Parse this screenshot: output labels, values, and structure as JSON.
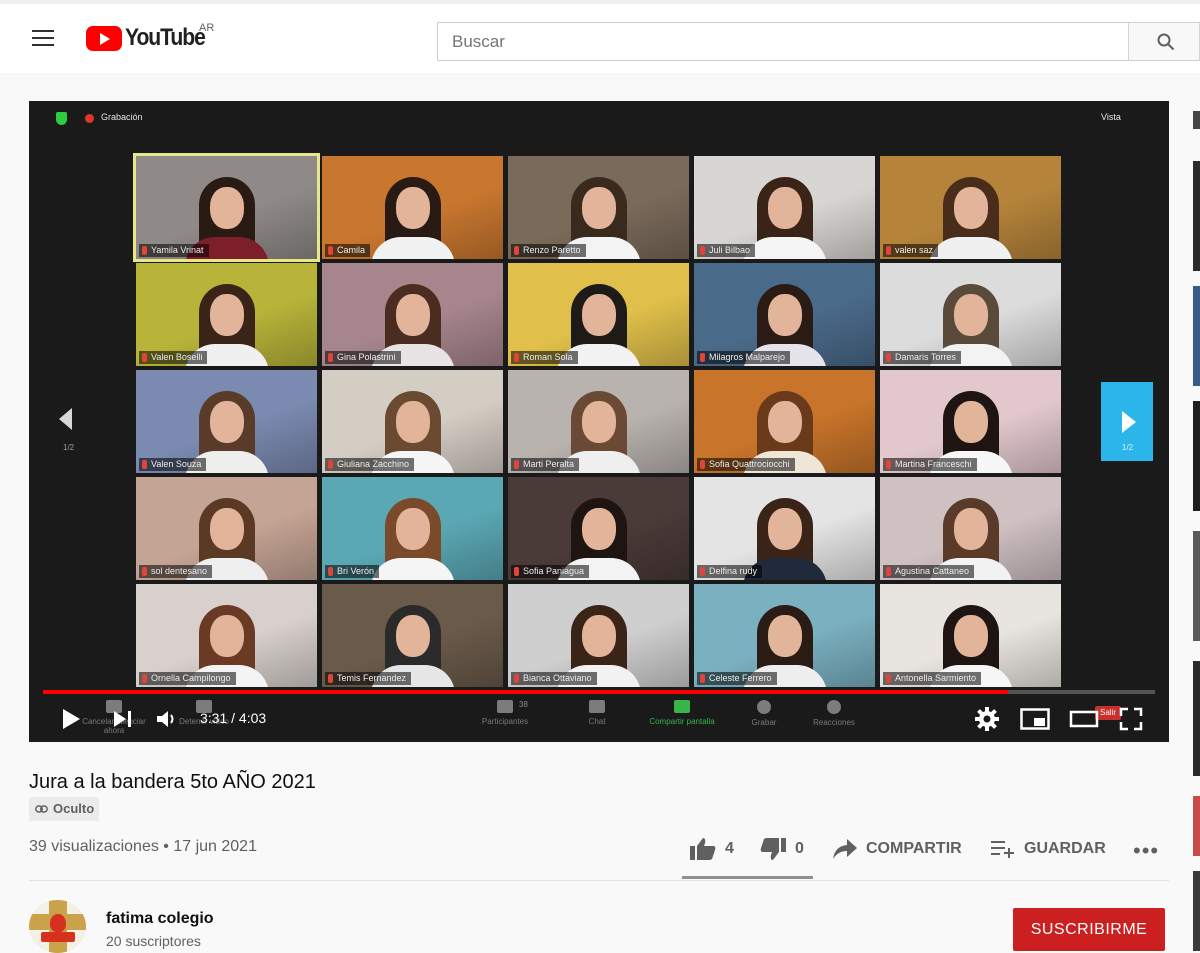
{
  "header": {
    "logo_text": "YouTube",
    "country_code": "AR",
    "search_placeholder": "Buscar"
  },
  "zoom": {
    "recording_label": "Grabación",
    "view_label": "Vista",
    "page_indicator_left": "1/2",
    "page_indicator_right": "1/2",
    "participants": [
      {
        "name": "Yamila Vrinat",
        "wall": "#8f8a88",
        "hair": "#2a1a14",
        "shirt": "#7d1f2a",
        "active": true
      },
      {
        "name": "Camila",
        "wall": "#c9772f",
        "hair": "#2a1a14",
        "shirt": "#f1f1f1"
      },
      {
        "name": "Renzo Paretto",
        "wall": "#7a6a5a",
        "hair": "#3a2a1e",
        "shirt": "#f3f3f3"
      },
      {
        "name": "Juli Bilbao",
        "wall": "#d8d6d2",
        "hair": "#3a2418",
        "shirt": "#f5f5f5"
      },
      {
        "name": "valen saz",
        "wall": "#b5843a",
        "hair": "#4a2c1a",
        "shirt": "#f0f0f0"
      },
      {
        "name": "Valen Boselli",
        "wall": "#b8b43a",
        "hair": "#3a2418",
        "shirt": "#f0f0f0"
      },
      {
        "name": "Gina Polastrini",
        "wall": "#a7858d",
        "hair": "#4a2c20",
        "shirt": "#e8e3e4"
      },
      {
        "name": "Roman Sola",
        "wall": "#e0c04a",
        "hair": "#1e1a18",
        "shirt": "#f2f2f2"
      },
      {
        "name": "Milagros Malparejo",
        "wall": "#4a6a8a",
        "hair": "#2a1c14",
        "shirt": "#e4e4ea"
      },
      {
        "name": "Damaris Torres",
        "wall": "#dcdcdc",
        "hair": "#5a4a3a",
        "shirt": "#f3f3f3"
      },
      {
        "name": "Valen Souza",
        "wall": "#7a8ab0",
        "hair": "#5a3a28",
        "shirt": "#eeeeee"
      },
      {
        "name": "Giuliana Zacchino",
        "wall": "#d4cdc4",
        "hair": "#6a4a30",
        "shirt": "#f5f5f5"
      },
      {
        "name": "Marti Peralta",
        "wall": "#b9b3af",
        "hair": "#6a4a34",
        "shirt": "#efefef"
      },
      {
        "name": "Sofia Quattrociocchi",
        "wall": "#c8742a",
        "hair": "#6a3a1a",
        "shirt": "#f0e6d8"
      },
      {
        "name": "Martina Franceschi",
        "wall": "#e2c8cc",
        "hair": "#1e1412",
        "shirt": "#f7f7f7"
      },
      {
        "name": "sol dentesano",
        "wall": "#c4a494",
        "hair": "#5a3a24",
        "shirt": "#efefef"
      },
      {
        "name": "Bri Verón",
        "wall": "#5aa8b4",
        "hair": "#7a4a2a",
        "shirt": "#f5f5f5"
      },
      {
        "name": "Sofia Paniagua",
        "wall": "#4a3a38",
        "hair": "#1e1412",
        "shirt": "#f3f3f3"
      },
      {
        "name": "Delfina rudy",
        "wall": "#e4e4e4",
        "hair": "#3a2418",
        "shirt": "#202a3a"
      },
      {
        "name": "Agustina Cattaneo",
        "wall": "#cfc0c2",
        "hair": "#5a3a28",
        "shirt": "#f2f2f2"
      },
      {
        "name": "Ornella Campilongo",
        "wall": "#d7d0cc",
        "hair": "#6a3a24",
        "shirt": "#f4f4f4"
      },
      {
        "name": "Temis Fernandez",
        "wall": "#6a5a4a",
        "hair": "#2a2a2a",
        "shirt": "#e6e6e6"
      },
      {
        "name": "Bianca Ottaviano",
        "wall": "#cfcfcf",
        "hair": "#3a2418",
        "shirt": "#f2f2f2"
      },
      {
        "name": "Celeste Ferrero",
        "wall": "#7ab0c0",
        "hair": "#2a1c14",
        "shirt": "#eeeeee"
      },
      {
        "name": "Antonella Sarmiento",
        "wall": "#e8e4df",
        "hair": "#1e1412",
        "shirt": "#f6f6f6"
      }
    ],
    "tools": {
      "cancel_mute": "Cancelar silenciar ahora",
      "stop_video": "Detener video",
      "participants": "Participantes",
      "participants_count": "38",
      "chat": "Chat",
      "share_screen": "Compartir pantalla",
      "record": "Grabar",
      "reactions": "Reacciones",
      "leave": "Salir"
    }
  },
  "player": {
    "current_time": "3:31 / 4:03",
    "progress_fraction": 0.868
  },
  "video": {
    "title": "Jura a la bandera 5to AÑO 2021",
    "visibility": "Oculto",
    "stats": "39 visualizaciones • 17 jun 2021",
    "likes": "4",
    "dislikes": "0",
    "share_label": "COMPARTIR",
    "save_label": "GUARDAR"
  },
  "channel": {
    "name": "fatima colegio",
    "subscribers": "20 suscriptores",
    "subscribe_label": "SUSCRIBIRME"
  },
  "colors": {
    "brand_red": "#ff0000",
    "subscribe_red": "#cc1f1f",
    "zoom_blue": "#2cb5e8",
    "zoom_green": "#38b54a"
  }
}
